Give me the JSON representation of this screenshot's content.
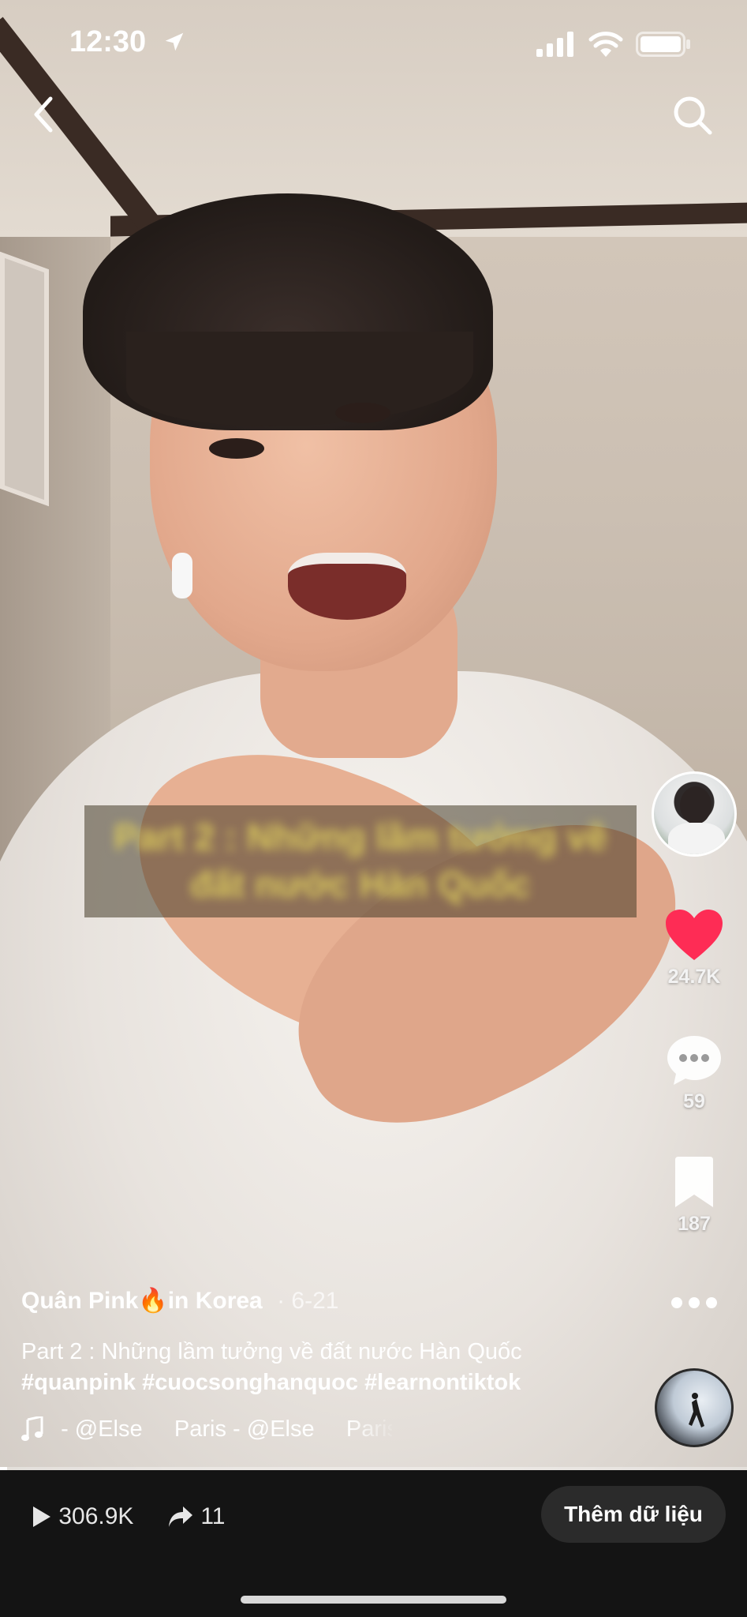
{
  "status_bar": {
    "time": "12:30"
  },
  "overlay_caption": {
    "line1": "Part 2 : Những lầm tưởng về",
    "line2": "đất nước Hàn Quốc"
  },
  "rail": {
    "likes": "24.7K",
    "comments": "59",
    "saves": "187"
  },
  "post": {
    "author": "Quân Pink🔥in Korea",
    "date": "· 6-21",
    "description": "Part 2 : Những lầm tưởng về đất nước Hàn Quốc",
    "hashtags": "#quanpink #cuocsonghanquoc #learnontiktok",
    "music": "- @Else     Paris - @Else     Paris"
  },
  "playback_progress": 0.01,
  "stats": {
    "views": "306.9K",
    "shares": "11"
  },
  "actions": {
    "add_data": "Thêm dữ liệu"
  },
  "colors": {
    "like": "#fe2c55",
    "bar_bg": "#141414",
    "button_bg": "#2b2b2b"
  }
}
